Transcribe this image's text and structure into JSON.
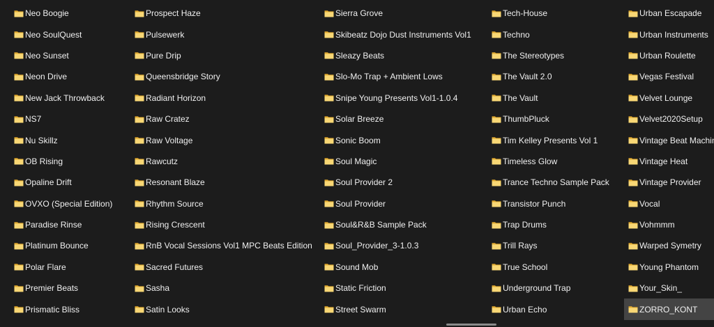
{
  "explorer": {
    "selected_item": "ZORRO_KONT",
    "icon": "folder-icon",
    "colors": {
      "background": "#1c1c1c",
      "text": "#f0f0f0",
      "selection": "#444444",
      "folder_back": "#e0a82e",
      "folder_front": "#f8d775"
    },
    "columns": [
      [
        "Neo Boogie",
        "Neo SoulQuest",
        "Neo Sunset",
        "Neon Drive",
        "New Jack Throwback",
        "NS7",
        "Nu Skillz",
        "OB Rising",
        "Opaline Drift",
        "OVXO (Special Edition)",
        "Paradise Rinse",
        "Platinum Bounce",
        "Polar Flare",
        "Premier Beats",
        "Prismatic Bliss"
      ],
      [
        "Prospect Haze",
        "Pulsewerk",
        "Pure Drip",
        "Queensbridge Story",
        "Radiant Horizon",
        "Raw Cratez",
        "Raw Voltage",
        "Rawcutz",
        "Resonant Blaze",
        "Rhythm Source",
        "Rising Crescent",
        "RnB Vocal Sessions Vol1 MPC Beats Edition",
        "Sacred Futures",
        "Sasha",
        "Satin Looks"
      ],
      [
        "Sierra Grove",
        "Skibeatz Dojo Dust Instruments Vol1",
        "Sleazy Beats",
        "Slo-Mo Trap + Ambient Lows",
        "Snipe Young Presents Vol1-1.0.4",
        "Solar Breeze",
        "Sonic Boom",
        "Soul Magic",
        "Soul Provider 2",
        "Soul Provider",
        "Soul&R&B Sample Pack",
        "Soul_Provider_3-1.0.3",
        "Sound Mob",
        "Static Friction",
        "Street Swarm"
      ],
      [
        "Tech-House",
        "Techno",
        "The Stereotypes",
        "The Vault 2.0",
        "The Vault",
        "ThumbPluck",
        "Tim Kelley Presents Vol 1",
        "Timeless Glow",
        "Trance Techno Sample Pack",
        "Transistor Punch",
        "Trap Drums",
        "Trill Rays",
        "True School",
        "Underground Trap",
        "Urban Echo"
      ],
      [
        "Urban Escapade",
        "Urban Instruments",
        "Urban Roulette",
        "Vegas Festival",
        "Velvet Lounge",
        "Velvet2020Setup",
        "Vintage Beat Machine",
        "Vintage Heat",
        "Vintage Provider",
        "Vocal",
        "Vohmmm",
        "Warped Symetry",
        "Young Phantom",
        "Your_Skin_",
        "ZORRO_KONT"
      ]
    ]
  }
}
